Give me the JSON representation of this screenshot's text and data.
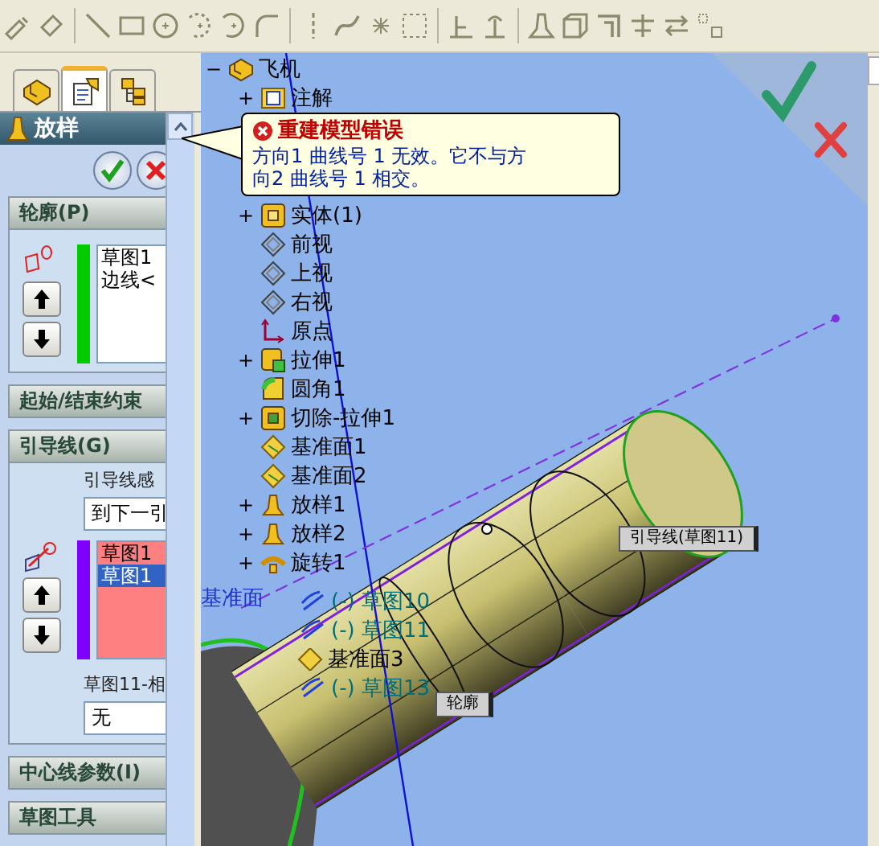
{
  "panel_tabs": [
    {
      "kind": "tree",
      "selected": false
    },
    {
      "kind": "property",
      "selected": true
    },
    {
      "kind": "config",
      "selected": false
    }
  ],
  "property_manager": {
    "title": "放样",
    "sections": [
      {
        "kind": "profiles",
        "title": "轮廓(P)",
        "color": "#00cc00",
        "items": [
          {
            "label": "草图1",
            "selected": false
          },
          {
            "label": "边线<",
            "selected": false
          }
        ]
      },
      {
        "kind": "collapsed",
        "title": "起始/结束约束"
      },
      {
        "kind": "guides",
        "title": "引导线(G)",
        "option_label": "引导线感",
        "option_value": "到下一引",
        "color": "#8000ff",
        "items": [
          {
            "label": "草图1",
            "selected": false
          },
          {
            "label": "草图1",
            "selected": true
          }
        ],
        "tangent_label": "草图11-相",
        "tangent_value": "无"
      },
      {
        "kind": "collapsed",
        "title": "中心线参数(I)"
      },
      {
        "kind": "collapsed",
        "title": "草图工具"
      }
    ]
  },
  "feature_tree": [
    {
      "label": "飞机",
      "kind": "part",
      "toggle": "−",
      "children": [
        {
          "label": "注解",
          "kind": "annotation",
          "toggle": "+"
        },
        {
          "label": "实体(1)",
          "kind": "solid",
          "toggle": "+"
        },
        {
          "label": "前视",
          "kind": "plane"
        },
        {
          "label": "上视",
          "kind": "plane"
        },
        {
          "label": "右视",
          "kind": "plane"
        },
        {
          "label": "原点",
          "kind": "origin"
        },
        {
          "label": "拉伸1",
          "kind": "extrude",
          "toggle": "+"
        },
        {
          "label": "圆角1",
          "kind": "fillet"
        },
        {
          "label": "切除-拉伸1",
          "kind": "cut",
          "toggle": "+"
        },
        {
          "label": "基准面1",
          "kind": "datum"
        },
        {
          "label": "基准面2",
          "kind": "datum"
        },
        {
          "label": "放样1",
          "kind": "loft",
          "toggle": "+"
        },
        {
          "label": "放样2",
          "kind": "loft",
          "toggle": "+"
        },
        {
          "label": "旋转1",
          "kind": "revolve",
          "toggle": "+"
        }
      ]
    }
  ],
  "viewport_labels": [
    {
      "text": "基准面",
      "kind": "plane"
    },
    {
      "text": "(-) 草图10",
      "kind": "sketch"
    },
    {
      "text": "(-) 草图11",
      "kind": "sketch"
    },
    {
      "text": "基准面3",
      "kind": "datum"
    },
    {
      "text": "(-) 草图13",
      "kind": "sketch"
    }
  ],
  "model_tags": [
    "引导线(草图11)",
    "轮廓"
  ],
  "error_callout": {
    "title": "重建模型错误",
    "lines": [
      "方向1 曲线号 1 无效。它不与方",
      "向2 曲线号 1 相交。"
    ]
  }
}
